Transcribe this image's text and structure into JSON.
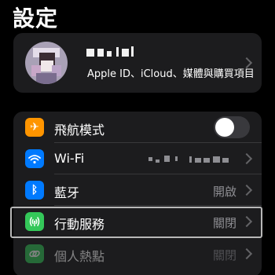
{
  "header": {
    "title": "設定"
  },
  "profile": {
    "subtitle": "Apple ID、iCloud、媒體與購買項目"
  },
  "settings": [
    {
      "key": "airplane",
      "label": "飛航模式",
      "icon": "airplane-icon",
      "icon_color": "#ff9500",
      "toggle_on": false
    },
    {
      "key": "wifi",
      "label": "Wi-Fi",
      "icon": "wifi-icon",
      "icon_color": "#007aff",
      "value": ""
    },
    {
      "key": "bluetooth",
      "label": "藍牙",
      "icon": "bluetooth-icon",
      "icon_color": "#007aff",
      "value": "開啟"
    },
    {
      "key": "cellular",
      "label": "行動服務",
      "icon": "antenna-icon",
      "icon_color": "#34c759",
      "value": "關閉"
    },
    {
      "key": "hotspot",
      "label": "個人熱點",
      "icon": "link-icon",
      "icon_color": "#34c759",
      "value": "關閉"
    }
  ],
  "colors": {
    "background": "#000000",
    "card": "#1c1c1e",
    "secondary_text": "#8e8e93"
  }
}
